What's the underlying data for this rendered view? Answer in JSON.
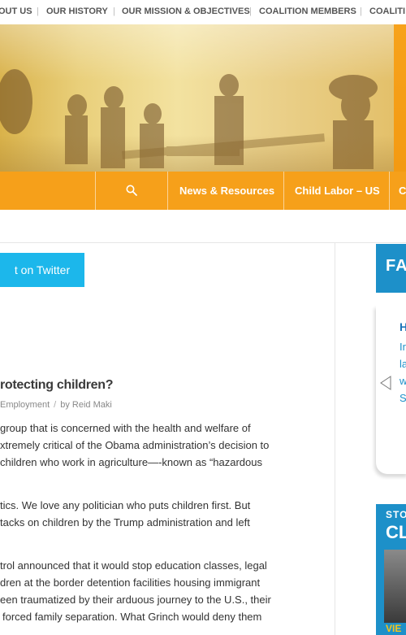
{
  "topnav": {
    "items": [
      "OUT US",
      "OUR HISTORY",
      "OUR MISSION & OBJECTIVES",
      "COALITION MEMBERS",
      "COALITI"
    ]
  },
  "menu": {
    "items": [
      "News & Resources",
      "Child Labor – US",
      "C"
    ]
  },
  "tweet": {
    "label": "t on Twitter"
  },
  "post": {
    "title": "rotecting children?",
    "category": "Employment",
    "by": "by",
    "author": "Reid Maki",
    "paragraphs": [
      [
        "group that is concerned with the health and welfare of",
        "xtremely critical of the Obama administration’s decision to",
        "children who work in agriculture—-known as “hazardous"
      ],
      [
        "tics. We love any politician who puts children first. But",
        "tacks on children by the Trump administration and left"
      ],
      [
        "trol announced that it would stop education classes, legal",
        "dren at the border detention facilities housing immigrant",
        "een traumatized by their arduous journey to the U.S., their",
        "forced family separation. What Grinch would deny them"
      ]
    ]
  },
  "sidebar": {
    "facts_title": "FA",
    "slide_heading": "H",
    "slide_lines": [
      "Ir",
      "la",
      "w",
      "S"
    ],
    "stop_top": "STO",
    "stop_big": "CL",
    "stop_bottom": "VIE"
  },
  "colors": {
    "orange": "#f6a01a",
    "twitter_blue": "#1cb7eb",
    "widget_blue": "#1d90c9"
  }
}
